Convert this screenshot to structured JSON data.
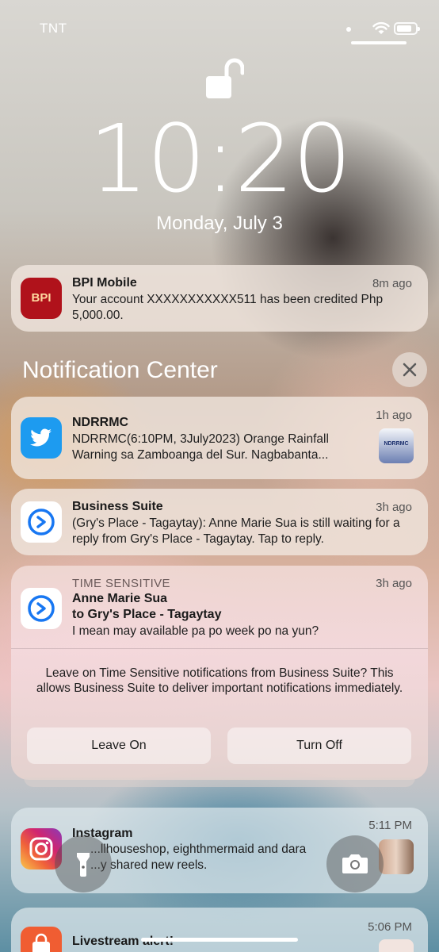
{
  "status_bar": {
    "carrier": "TNT"
  },
  "lock_screen": {
    "time": "10:20",
    "date": "Monday, July 3"
  },
  "pinned": {
    "app": "BPI Mobile",
    "icon_text": "BPI",
    "age": "8m ago",
    "body": "Your account XXXXXXXXXXX511 has been credited Php 5,000.00."
  },
  "notification_center": {
    "title": "Notification Center"
  },
  "notifications": [
    {
      "app": "NDRRMC",
      "age": "1h ago",
      "body": "NDRRMC(6:10PM, 3July2023) Orange Rainfall Warning sa Zamboanga del Sur. Nagbabanta...",
      "thumb_text": "NDRRMC"
    },
    {
      "app": "Business Suite",
      "age": "3h ago",
      "body": "(Gry's Place - Tagaytay): Anne Marie Sua is still waiting for a reply from Gry's Place - Tagaytay. Tap to reply."
    }
  ],
  "time_sensitive": {
    "label": "TIME SENSITIVE",
    "age": "3h ago",
    "sender": "Anne Marie Sua",
    "to": "to Gry's Place - Tagaytay",
    "body": "I mean may available pa po week po na yun?",
    "prompt": "Leave on Time Sensitive notifications from Business Suite? This allows Business Suite to deliver important notifications immediately.",
    "leave_on": "Leave On",
    "turn_off": "Turn Off"
  },
  "instagram": {
    "app": "Instagram",
    "age": "5:11 PM",
    "body_line1": "...llhouseshop, eighthmermaid and dara",
    "body_line2": "...y shared new reels."
  },
  "livestream": {
    "app": "Livestream alert!",
    "age": "5:06 PM"
  },
  "colors": {
    "bpi_red": "#b0121b",
    "twitter_blue": "#1d9bf0",
    "meta_blue": "#1877f2"
  }
}
